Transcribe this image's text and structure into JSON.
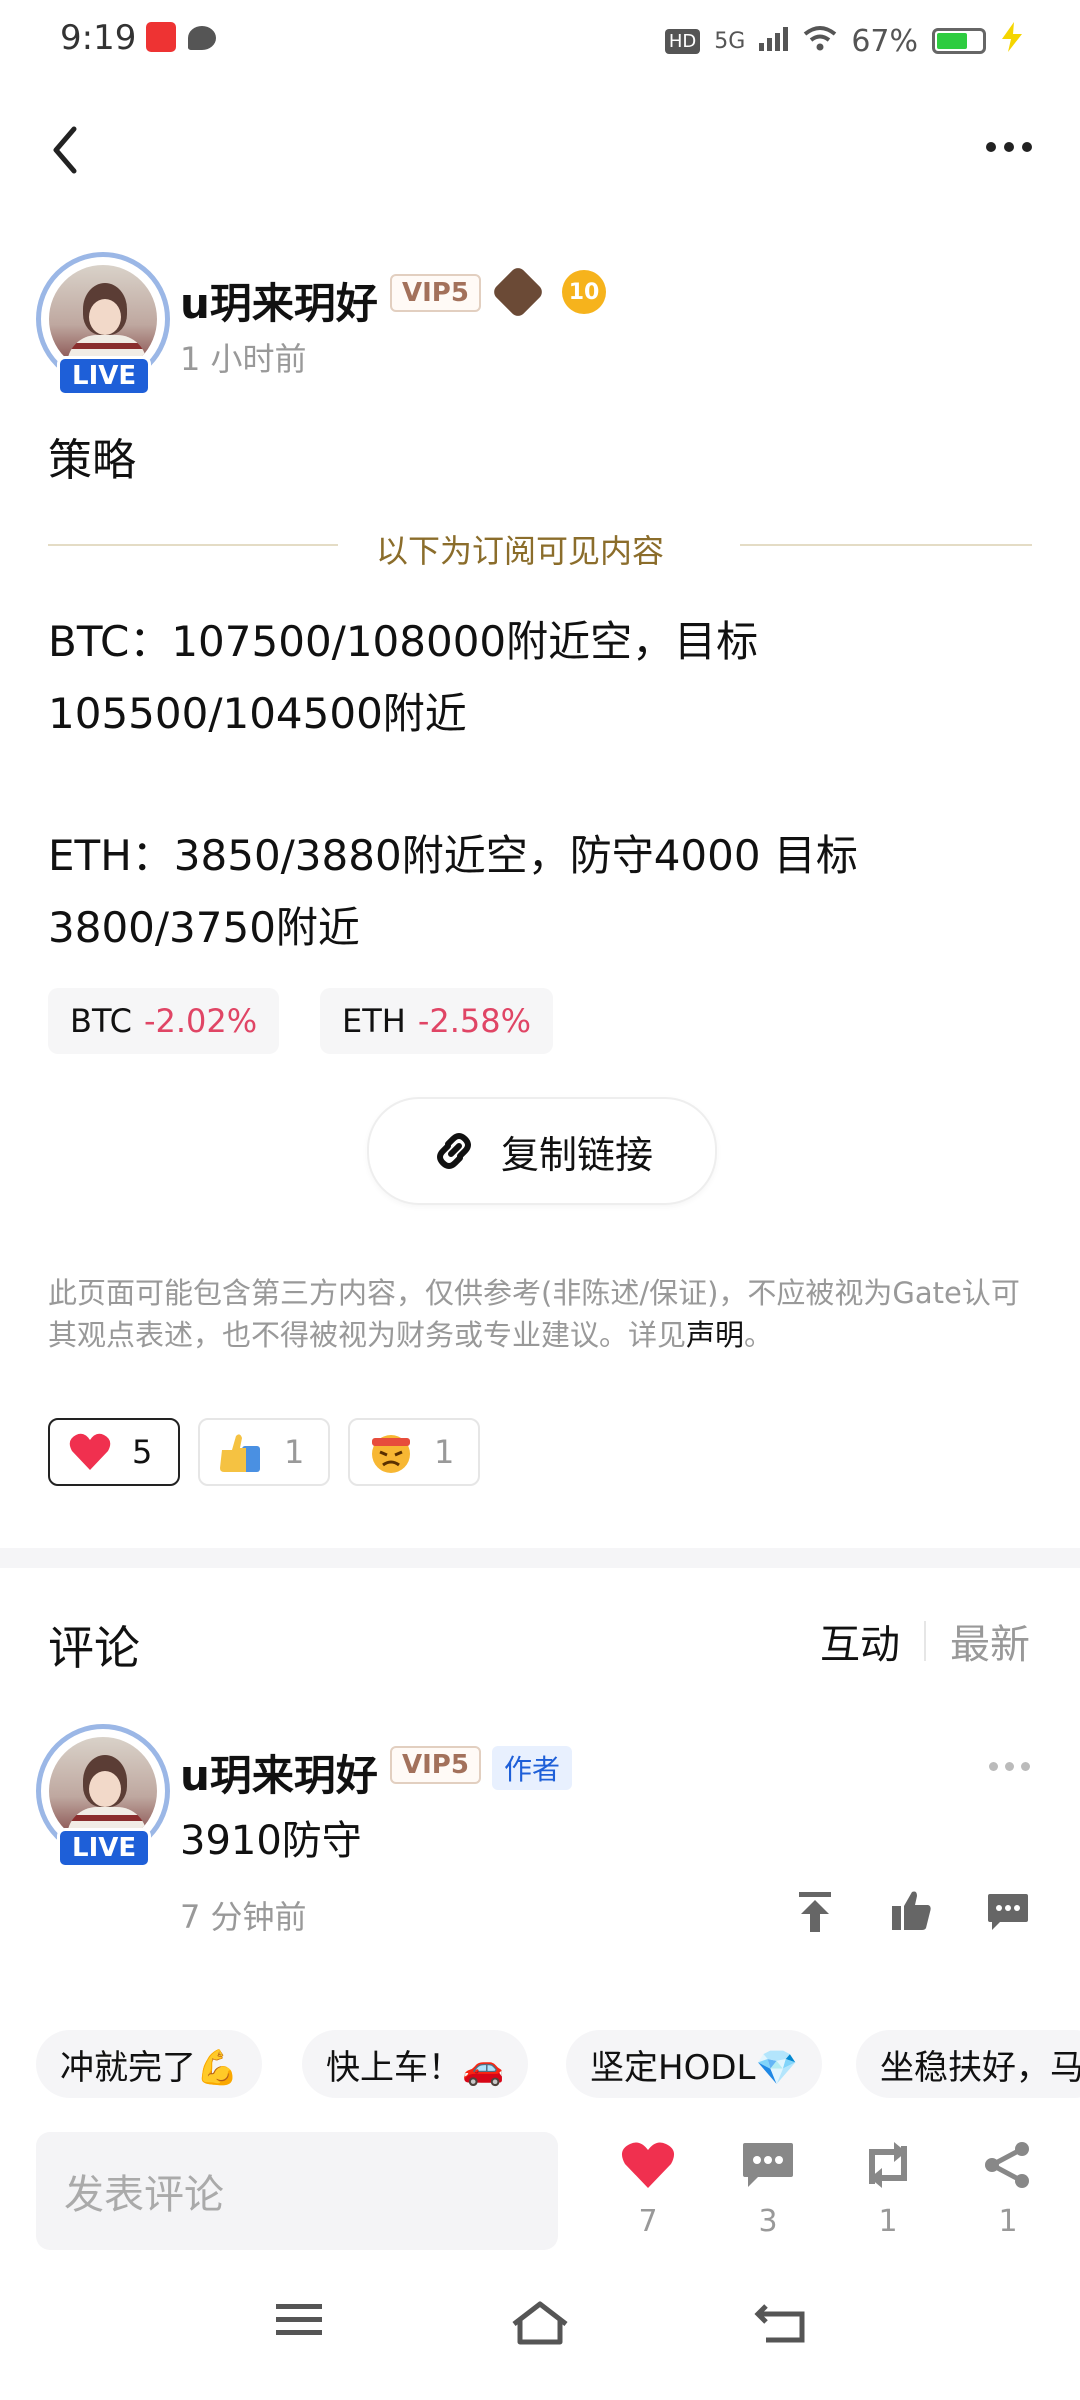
{
  "status_bar": {
    "time": "9:19",
    "network": "5G",
    "battery": "67%"
  },
  "post": {
    "author": {
      "name": "u玥来玥好",
      "vip": "VIP5",
      "live_label": "LIVE",
      "level": "10",
      "time": "1 小时前"
    },
    "title": "策略",
    "subscriber_divider": "以下为订阅可见内容",
    "lines": [
      "BTC：107500/108000附近空，目标",
      "105500/104500附近",
      "ETH：3850/3880附近空，防守4000 目标",
      "3800/3750附近"
    ],
    "tags": [
      {
        "symbol": "BTC",
        "change": "-2.02%"
      },
      {
        "symbol": "ETH",
        "change": "-2.58%"
      }
    ],
    "copy_link": "复制链接",
    "disclaimer": "此页面可能包含第三方内容，仅供参考(非陈述/保证)，不应被视为Gate认可其观点表述，也不得被视为财务或专业建议。详见",
    "disclaimer_link": "声明",
    "disclaimer_end": "。",
    "reactions": [
      {
        "icon": "heart-icon",
        "count": "5"
      },
      {
        "icon": "thumbs-up-icon",
        "count": "1"
      },
      {
        "icon": "angry-face-icon",
        "count": "1"
      }
    ]
  },
  "comments": {
    "title": "评论",
    "sort_active": "互动",
    "sort_inactive": "最新",
    "items": [
      {
        "name": "u玥来玥好",
        "vip": "VIP5",
        "author_tag": "作者",
        "live_label": "LIVE",
        "text": "3910防守",
        "time": "7 分钟前"
      }
    ]
  },
  "quick_replies": [
    "冲就完了💪",
    "快上车！🚗",
    "坚定HODL💎",
    "坐稳扶好，马"
  ],
  "bottom_bar": {
    "placeholder": "发表评论",
    "like_count": "7",
    "comment_count": "3",
    "repost_count": "1",
    "share_count": "1"
  },
  "colors": {
    "accent_blue": "#1e5fd8",
    "negative": "#e04565",
    "heart": "#f0304f",
    "gold_text": "#8b6d2b"
  }
}
